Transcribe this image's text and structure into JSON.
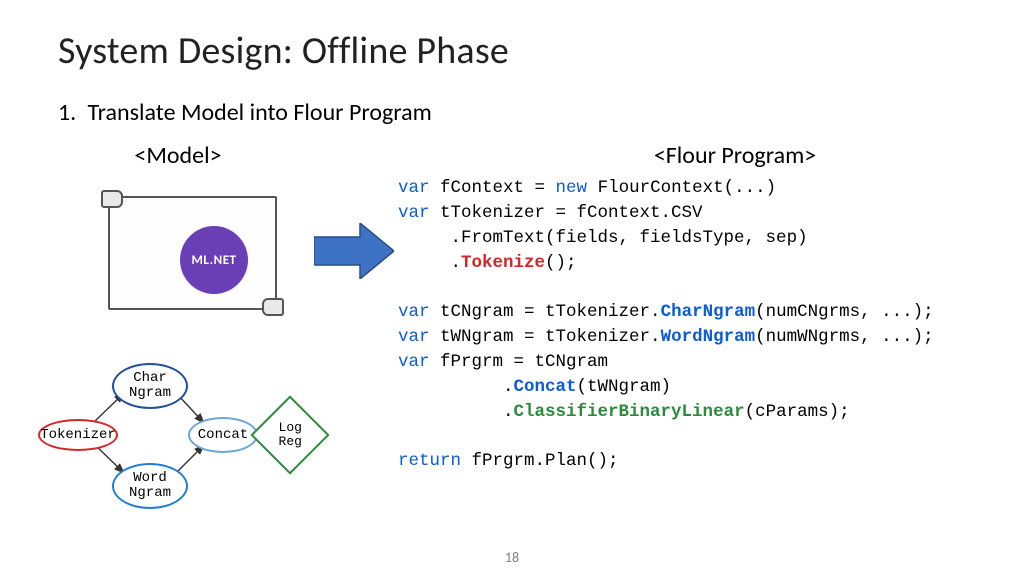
{
  "title": "System Design: Offline Phase",
  "subtitle_number": "1.",
  "subtitle_text": "Translate Model into Flour Program",
  "left_heading": "<Model>",
  "right_heading": "<Flour Program>",
  "mlnet_label": "ML.NET",
  "pipeline": {
    "tokenizer": "Tokenizer",
    "char_ngram": "Char\nNgram",
    "word_ngram": "Word\nNgram",
    "concat": "Concat",
    "logreg": "Log\nReg"
  },
  "code": {
    "l1a": "var",
    "l1b": " fContext = ",
    "l1c": "new",
    "l1d": " FlourContext(...)",
    "l2a": "var",
    "l2b": " tTokenizer = fContext.CSV",
    "l3": "     .FromText(fields, fieldsType, sep)",
    "l4a": "     .",
    "l4b": "Tokenize",
    "l4c": "();",
    "blank1": "",
    "l5a": "var",
    "l5b": " tCNgram = tTokenizer.",
    "l5c": "CharNgram",
    "l5d": "(numCNgrms, ...);",
    "l6a": "var",
    "l6b": " tWNgram = tTokenizer.",
    "l6c": "WordNgram",
    "l6d": "(numWNgrms, ...);",
    "l7a": "var",
    "l7b": " fPrgrm = tCNgram",
    "l8a": "          .",
    "l8b": "Concat",
    "l8c": "(tWNgram)",
    "l9a": "          .",
    "l9b": "ClassifierBinaryLinear",
    "l9c": "(cParams);",
    "blank2": "",
    "l10a": "return",
    "l10b": " fPrgrm.Plan();"
  },
  "page_number": "18"
}
